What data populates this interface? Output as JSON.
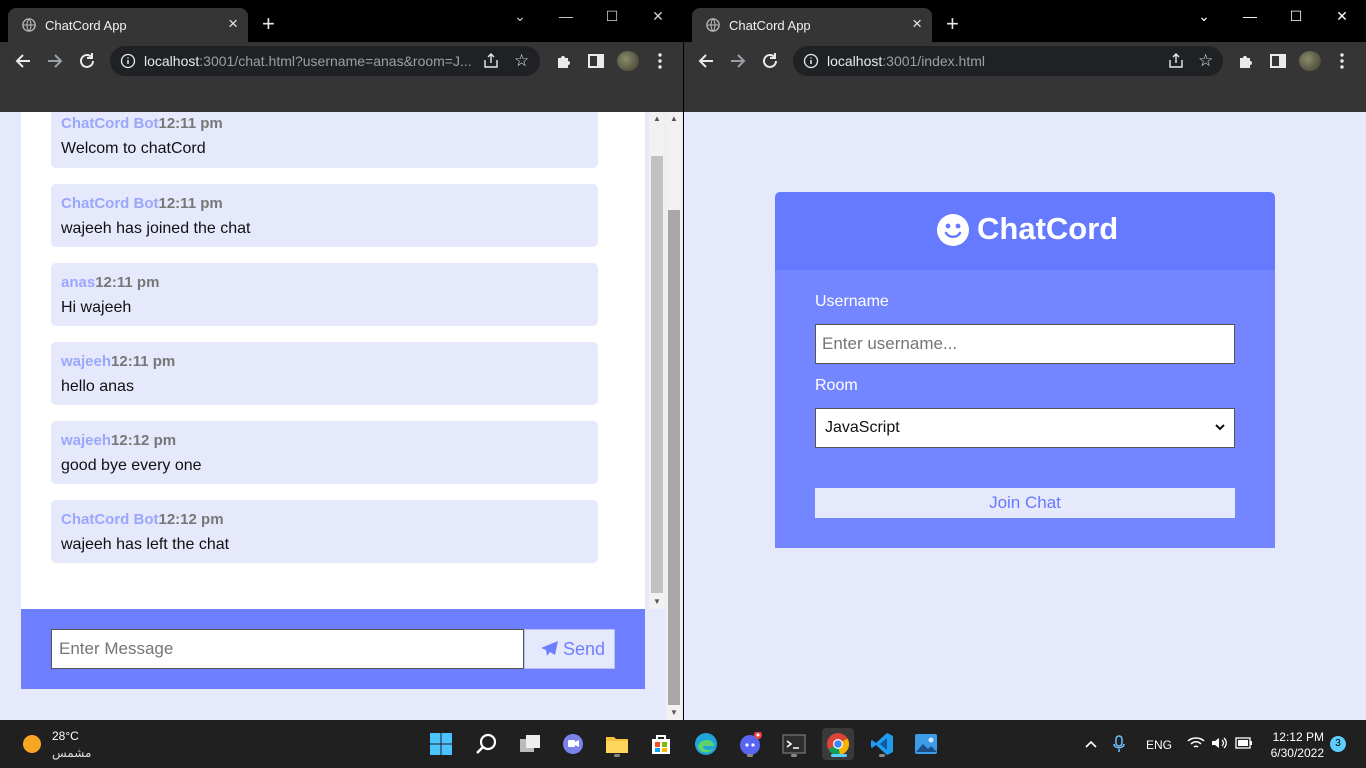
{
  "left_window": {
    "tab_title": "ChatCord App",
    "url_host": "localhost",
    "url_rest": ":3001/chat.html?username=anas&room=J...",
    "messages": [
      {
        "user": "ChatCord Bot",
        "time": "12:11 pm",
        "text": "Welcom to chatCord"
      },
      {
        "user": "ChatCord Bot",
        "time": "12:11 pm",
        "text": "wajeeh has joined the chat"
      },
      {
        "user": "anas",
        "time": "12:11 pm",
        "text": "Hi wajeeh"
      },
      {
        "user": "wajeeh",
        "time": "12:11 pm",
        "text": "hello anas"
      },
      {
        "user": "wajeeh",
        "time": "12:12 pm",
        "text": "good bye every one"
      },
      {
        "user": "ChatCord Bot",
        "time": "12:12 pm",
        "text": "wajeeh has left the chat"
      }
    ],
    "message_input_placeholder": "Enter Message",
    "send_label": "Send"
  },
  "right_window": {
    "tab_title": "ChatCord App",
    "url_host": "localhost",
    "url_rest": ":3001/index.html",
    "brand": "ChatCord",
    "username_label": "Username",
    "username_placeholder": "Enter username...",
    "room_label": "Room",
    "room_selected": "JavaScript",
    "join_label": "Join Chat"
  },
  "taskbar": {
    "temperature": "28°C",
    "condition": "مشمس",
    "language": "ENG",
    "time": "12:12 PM",
    "date": "6/30/2022",
    "notification_count": "3"
  },
  "colors": {
    "primary": "#667aff",
    "secondary": "#7386ff",
    "light": "#e6e9fb",
    "username_color": "#99a7fd"
  }
}
